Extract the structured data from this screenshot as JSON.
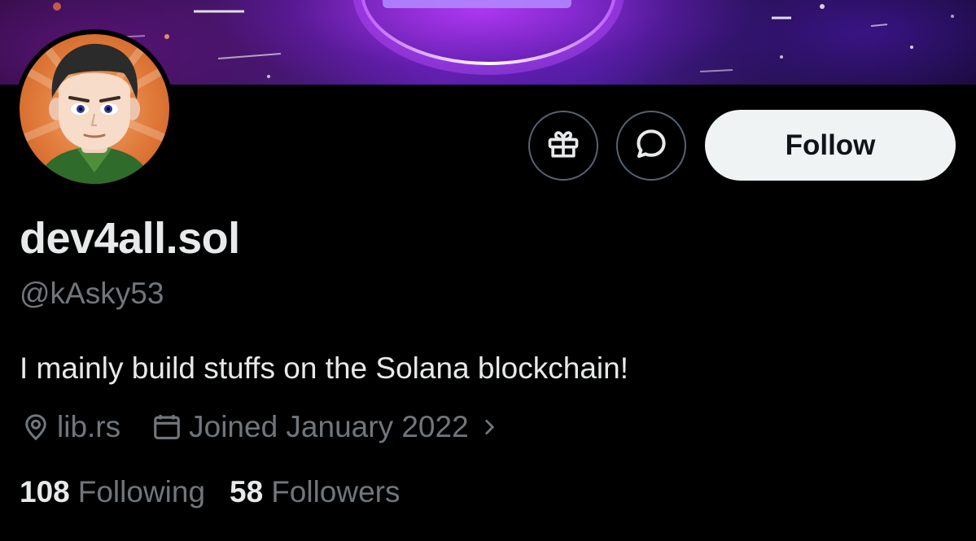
{
  "colors": {
    "background": "#000000",
    "text_primary": "#e7e9ea",
    "text_secondary": "#71767b",
    "button_border": "#536471",
    "follow_button_bg": "#eff3f4",
    "follow_button_text": "#0f1419"
  },
  "profile": {
    "display_name": "dev4all.sol",
    "handle": "@kAsky53",
    "bio": "I mainly build stuffs on the Solana blockchain!",
    "website": "lib.rs",
    "joined": "Joined January 2022"
  },
  "actions": {
    "gift_icon": "gift-icon",
    "message_icon": "message-icon",
    "follow_label": "Follow"
  },
  "stats": {
    "following_count": "108",
    "following_label": "Following",
    "followers_count": "58",
    "followers_label": "Followers"
  },
  "icons": {
    "location": "location-pin-icon",
    "calendar": "calendar-icon",
    "chevron": "chevron-right-icon"
  }
}
